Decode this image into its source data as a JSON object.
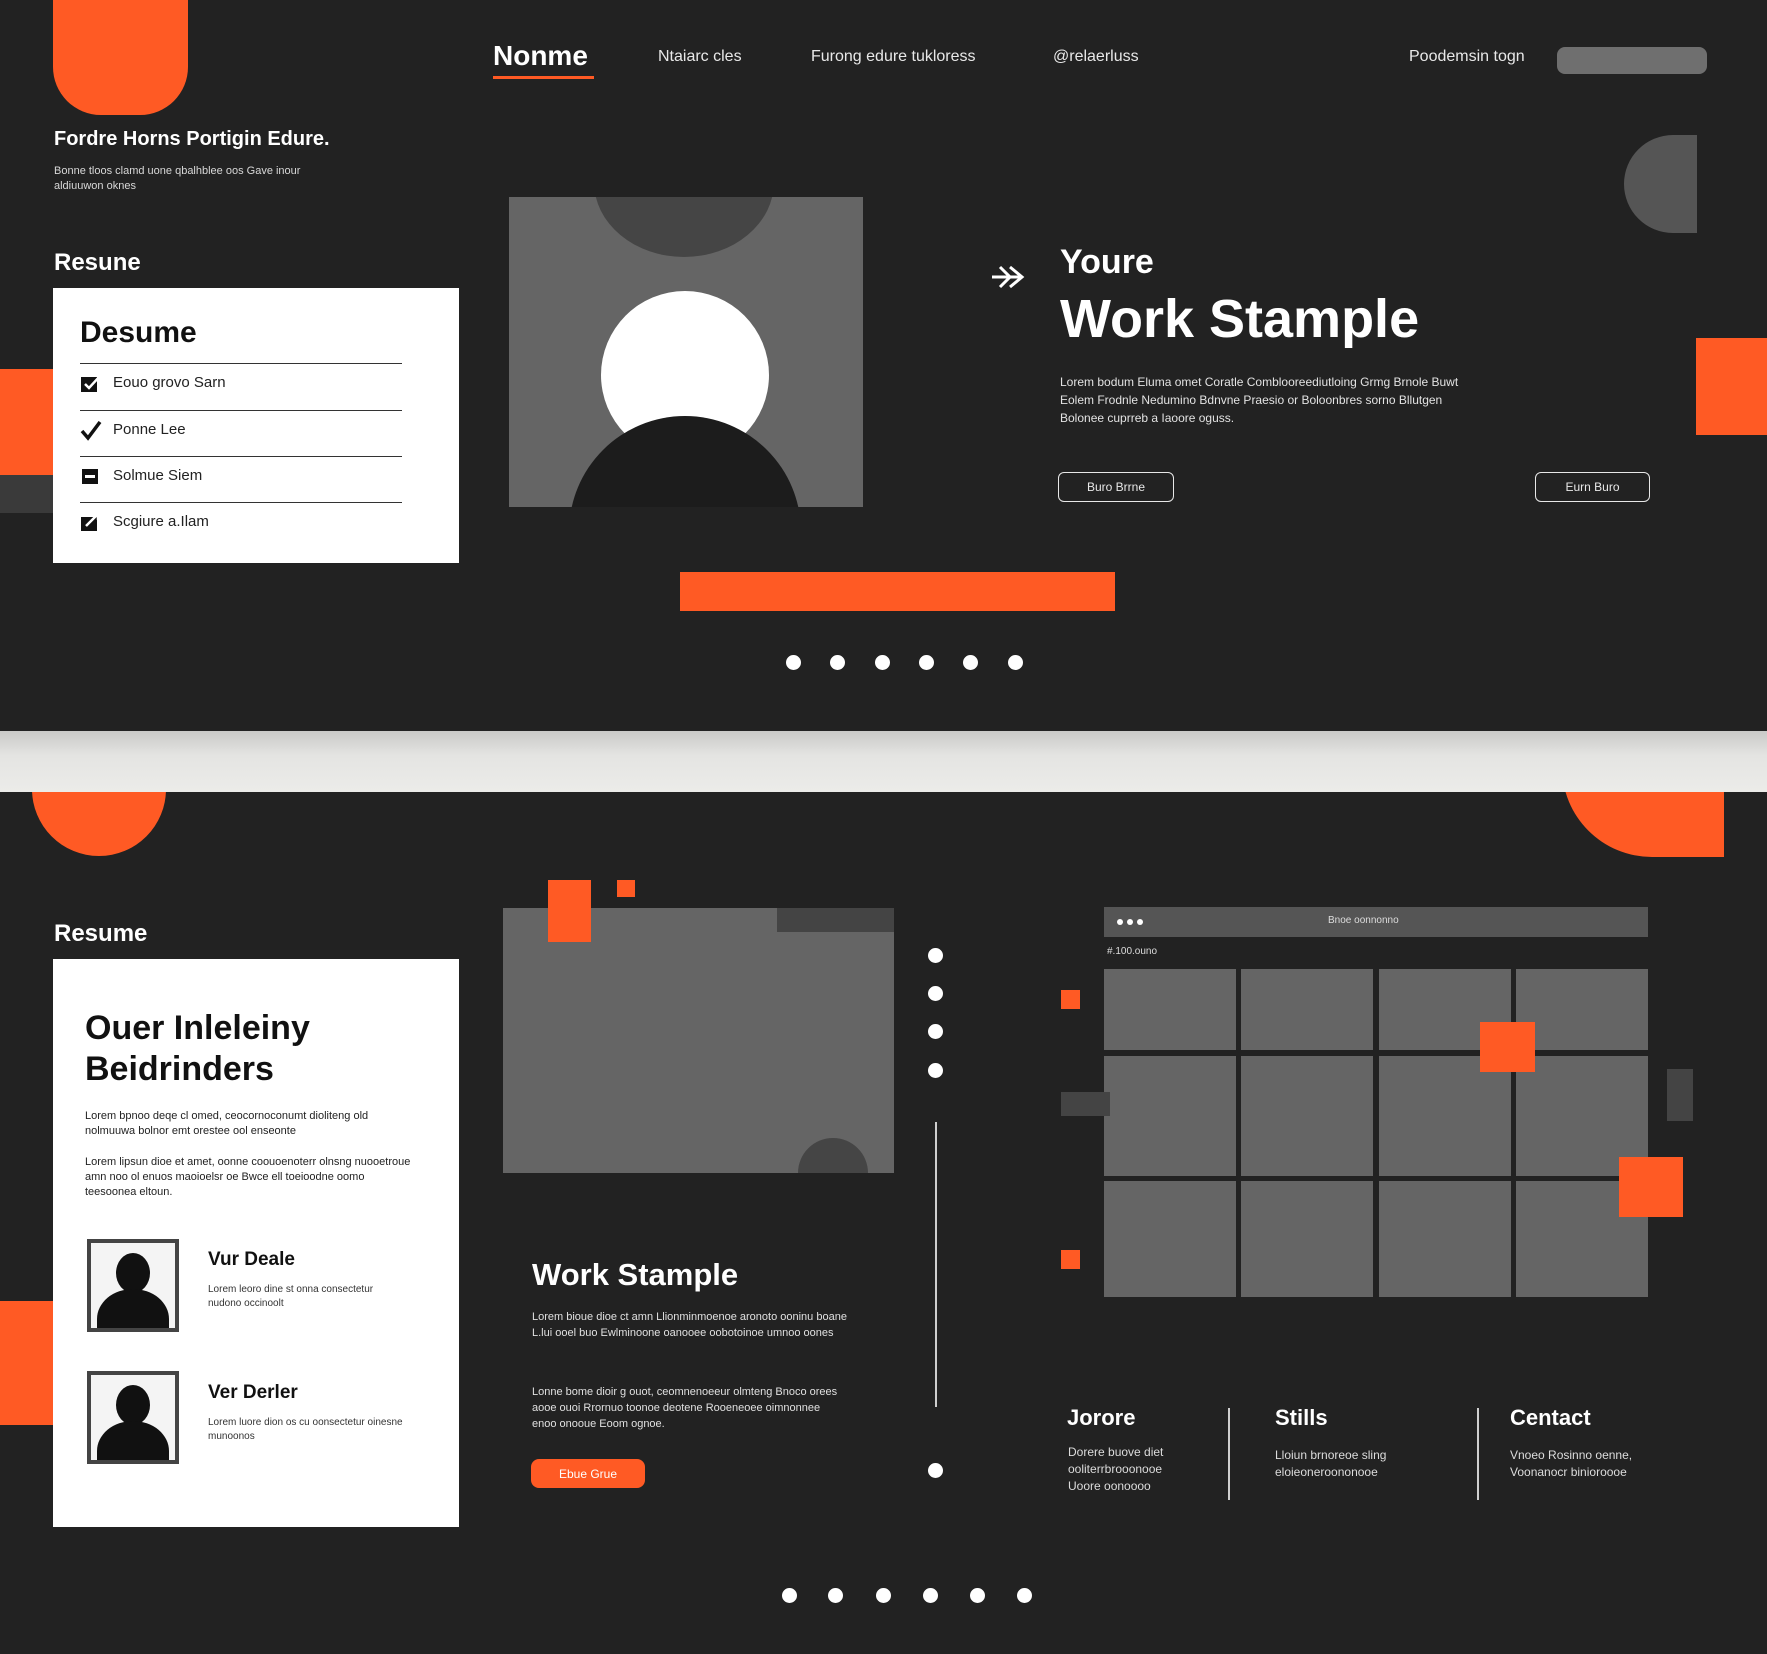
{
  "colors": {
    "background": "#222222",
    "accent": "#ff5a24",
    "placeholder_grey": "#656565",
    "card": "#ffffff"
  },
  "nav": {
    "brand": "Nonme",
    "links": [
      "Ntaiarc cles",
      "Furong edure tukloress",
      "@relaerluss"
    ],
    "login_label": "Poodemsin togn"
  },
  "hero": {
    "tagline": "Fordre Horns Portigin Edure.",
    "subtagline": "Bonne tloos clamd uone qbalhblee oos Gave inour aldiuuwon oknes",
    "arrow_icon": "double-arrow-right-icon",
    "kicker": "Youre",
    "title": "Work Stample",
    "body": "Lorem bodum Eluma omet Coratle Comblooreediutloing Grmg Brnole Buwt Eolem Frodnle Nedumino Bdnvne Praesio or Boloonbres sorno Bllutgen Bolonee cuprreb a Iaoore oguss.",
    "button_left": "Buro Brrne",
    "button_right": "Eurn Buro"
  },
  "resume_top": {
    "heading": "Resune",
    "card_title": "Desume",
    "items": [
      {
        "icon": "checkbox-checked-icon",
        "label": "Eouo grovo Sarn"
      },
      {
        "icon": "checkmark-icon",
        "label": "Ponne Lee"
      },
      {
        "icon": "inbox-icon",
        "label": "Solmue Siem"
      },
      {
        "icon": "link-icon",
        "label": "Scgiure a.Ilam"
      }
    ]
  },
  "carousel_top": {
    "dots": 6,
    "active_index": 0
  },
  "resume_bottom": {
    "heading": "Resume",
    "card_title_line1": "Ouer Inleleiny",
    "card_title_line2": "Beidrinders",
    "para1": "Lorem bpnoo deqe cl omed, ceocornoconumt dioliteng old nolmuuwa bolnor emt orestee ool enseonte",
    "para2": "Lorem lipsun dioe et amet, oonne coouoenoterr olnsng nuooetroue amn noo ol enuos maoioelsr oe Bwce ell toeioodne oomo teesoonea eltoun.",
    "people": [
      {
        "name": "Vur Deale",
        "text": "Lorem leoro dine st onna consectetur nudono occinoolt"
      },
      {
        "name": "Ver Derler",
        "text": "Lorem luore dion os cu oonsectetur oinesne munoonos"
      }
    ]
  },
  "work_bottom": {
    "title": "Work Stample",
    "para1": "Lorem bioue dioe ct amn Llionminmoenoe aronoto ooninu boane L.lui ooel buo Ewlminoone oanooee oobotoinoe umnoo oones",
    "para2": "Lonne bome dioir g ouot, ceomnenoeeur olmteng Bnoco orees aooe ouoi Rrornuo toonoe deotene Rooeneoee oimnonnee enoo onooue Eoom ognoe.",
    "button": "Ebue Grue"
  },
  "browser_mock": {
    "title": "Bnoe oonnonno",
    "subtitle": "#.100.ouno"
  },
  "columns": [
    {
      "title": "Jorore",
      "text": "Dorere buove diet ooliterrbrooonooe Uoore oonoooo"
    },
    {
      "title": "Stills",
      "text": "Lloiun brnoreoe sling eloieoneroononooe"
    },
    {
      "title": "Centact",
      "text": "Vnoeo Rosinno oenne, Voonanocr binioroooe"
    }
  ],
  "carousel_bottom": {
    "dots": 6,
    "active_index": 0
  }
}
